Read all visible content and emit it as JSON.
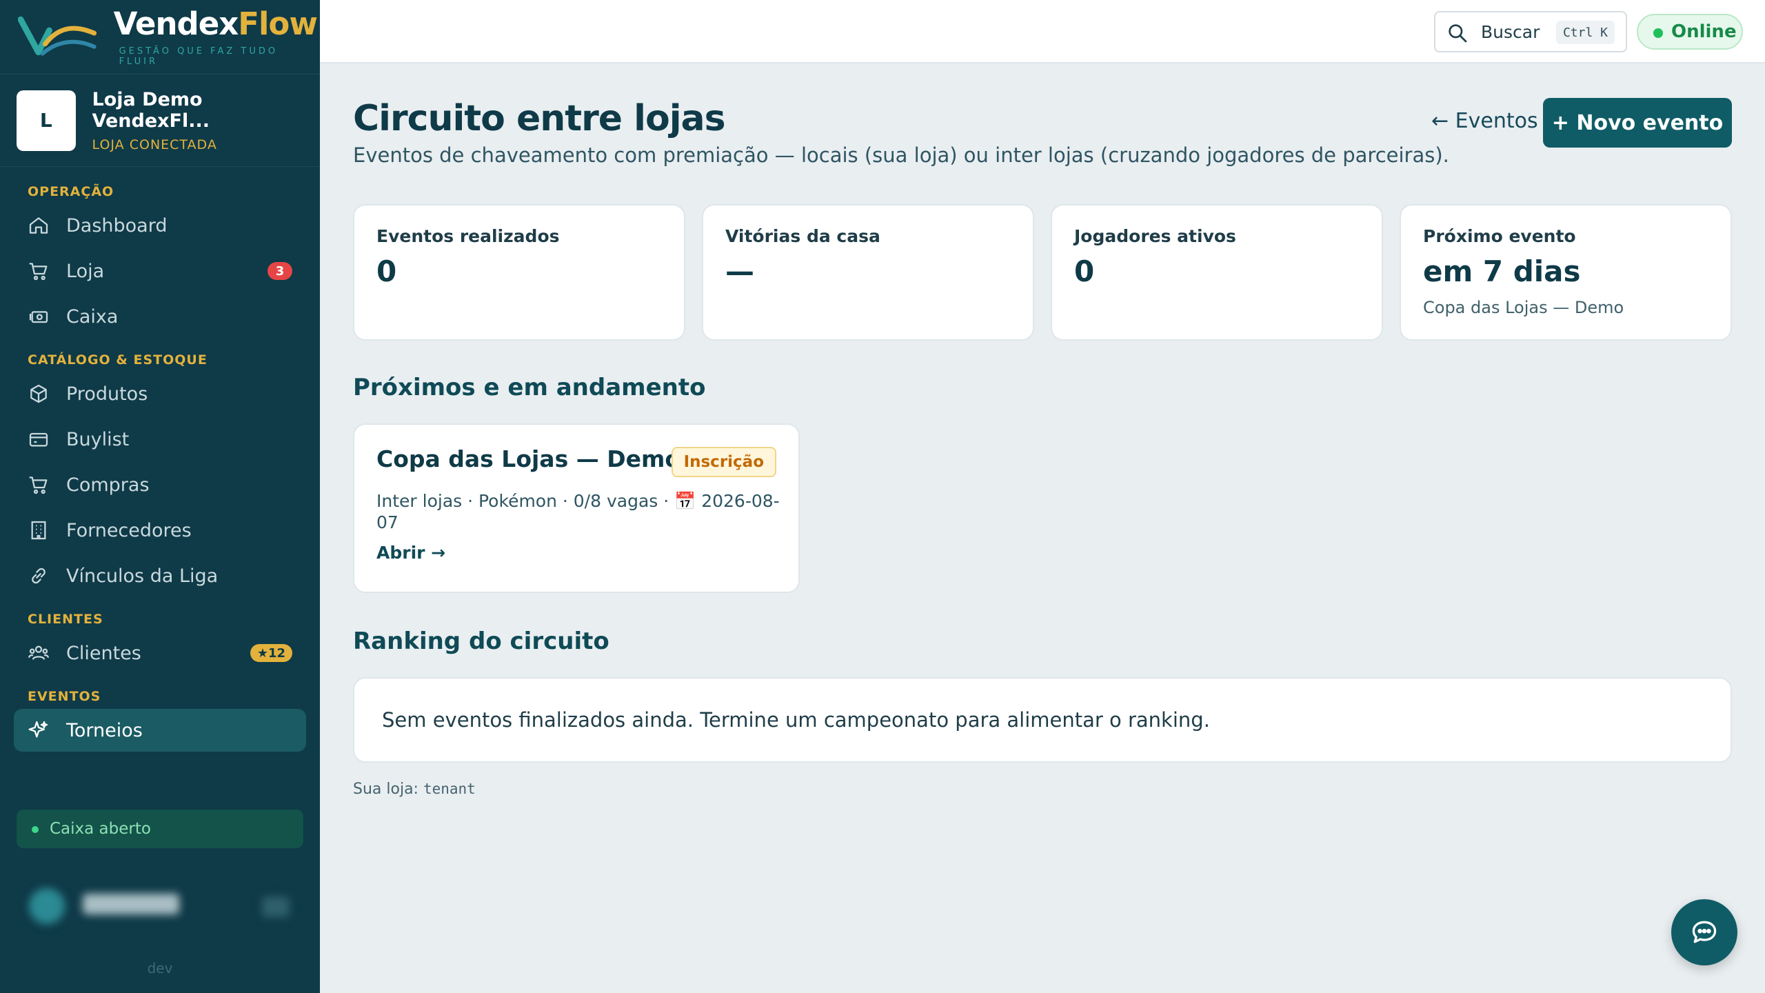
{
  "brand": {
    "name_part1": "Vendex",
    "name_part2": "Flow",
    "tagline": "GESTÃO QUE FAZ TUDO FLUIR"
  },
  "store": {
    "initial": "L",
    "name": "Loja Demo VendexFl...",
    "status": "LOJA CONECTADA"
  },
  "nav": {
    "sections": [
      {
        "label": "OPERAÇÃO",
        "items": [
          {
            "label": "Dashboard",
            "icon": "home-icon"
          },
          {
            "label": "Loja",
            "icon": "cart-icon",
            "badge": "3"
          },
          {
            "label": "Caixa",
            "icon": "cash-icon"
          }
        ]
      },
      {
        "label": "CATÁLOGO & ESTOQUE",
        "items": [
          {
            "label": "Produtos",
            "icon": "box-icon"
          },
          {
            "label": "Buylist",
            "icon": "card-icon"
          },
          {
            "label": "Compras",
            "icon": "cart-icon"
          },
          {
            "label": "Fornecedores",
            "icon": "building-icon"
          },
          {
            "label": "Vínculos da Liga",
            "icon": "link-icon"
          }
        ]
      },
      {
        "label": "CLIENTES",
        "items": [
          {
            "label": "Clientes",
            "icon": "users-icon",
            "badge": "★12"
          }
        ]
      },
      {
        "label": "EVENTOS",
        "items": [
          {
            "label": "Torneios",
            "icon": "sparkle-icon",
            "active": true
          }
        ]
      }
    ]
  },
  "caixa_status": "Caixa aberto",
  "env_label": "dev",
  "topbar": {
    "search_label": "Buscar",
    "search_shortcut": "Ctrl K",
    "status": "Online"
  },
  "page": {
    "title": "Circuito entre lojas",
    "subtitle": "Eventos de chaveamento com premiação — locais (sua loja) ou inter lojas (cruzando jogadores de parceiras).",
    "back_link": "← Eventos",
    "new_button": "+ Novo evento"
  },
  "stats": [
    {
      "label": "Eventos realizados",
      "value": "0"
    },
    {
      "label": "Vitórias da casa",
      "value": "—"
    },
    {
      "label": "Jogadores ativos",
      "value": "0"
    },
    {
      "label": "Próximo evento",
      "value": "em 7 dias",
      "note": "Copa das Lojas — Demo"
    }
  ],
  "upcoming": {
    "title": "Próximos e em andamento",
    "event": {
      "name": "Copa das Lojas — Demo",
      "badge": "Inscrição",
      "meta": "Inter lojas · Pokémon · 0/8 vagas · 📅 2026-08-07",
      "open": "Abrir →"
    }
  },
  "ranking": {
    "title": "Ranking do circuito",
    "empty": "Sem eventos finalizados ainda. Termine um campeonato para alimentar o ranking."
  },
  "footer": {
    "label": "Sua loja:",
    "tenant": "tenant"
  },
  "colors": {
    "sidebar": "#0f3a48",
    "accent": "#0f5c66",
    "gold": "#e3b23c",
    "online": "#1fbf5c",
    "badge": "#e64545"
  }
}
